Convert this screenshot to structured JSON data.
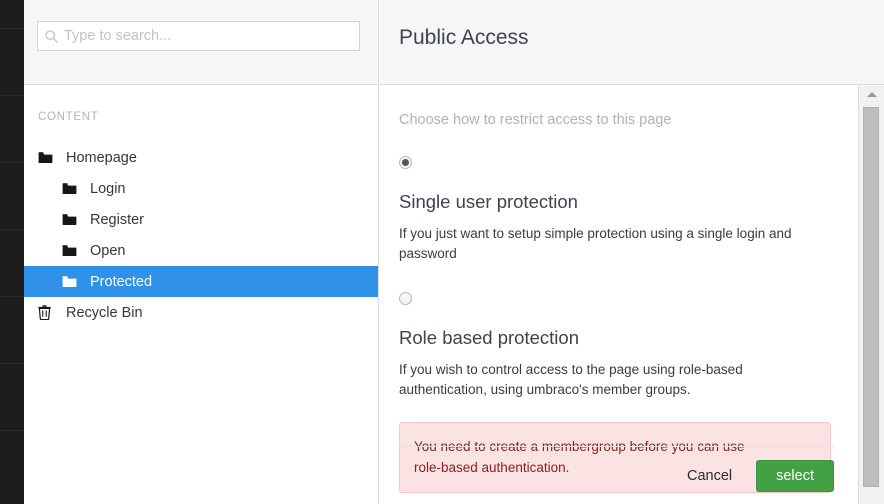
{
  "rail": {
    "separator_count": 7
  },
  "search": {
    "placeholder": "Type to search...",
    "value": "",
    "icon": "search-icon"
  },
  "tree": {
    "section_label": "CONTENT",
    "items": [
      {
        "label": "Homepage",
        "level": 0,
        "icon": "folder-icon",
        "selected": false
      },
      {
        "label": "Login",
        "level": 1,
        "icon": "folder-icon",
        "selected": false
      },
      {
        "label": "Register",
        "level": 1,
        "icon": "folder-icon",
        "selected": false
      },
      {
        "label": "Open",
        "level": 1,
        "icon": "folder-icon",
        "selected": false
      },
      {
        "label": "Protected",
        "level": 1,
        "icon": "folder-icon",
        "selected": true
      },
      {
        "label": "Recycle Bin",
        "level": 0,
        "icon": "trash-icon",
        "selected": false
      }
    ]
  },
  "panel": {
    "title": "Public Access",
    "subtitle": "Choose how to restrict access to this page",
    "options": [
      {
        "title": "Single user protection",
        "description": "If you just want to setup simple protection using a single login and password",
        "selected": true
      },
      {
        "title": "Role based protection",
        "description": "If you wish to control access to the page using role-based authentication, using umbraco's member groups.",
        "selected": false
      }
    ],
    "notice": {
      "line1": "You need to create a membergroup before you can use",
      "line2": "role-based authentication."
    },
    "footer": {
      "cancel_label": "Cancel",
      "select_label": "select"
    }
  },
  "scrollbar": {
    "up_arrow_icon": "triangle-up-icon"
  },
  "colors": {
    "accent_selected": "#3091e8",
    "primary_button": "#42a142",
    "notice_bg": "#fbe3e4",
    "notice_border": "#f3c7c9",
    "notice_text": "#8a1f1f",
    "rail_dark": "#1d1d1d",
    "header_bg": "#f6f6f6"
  }
}
